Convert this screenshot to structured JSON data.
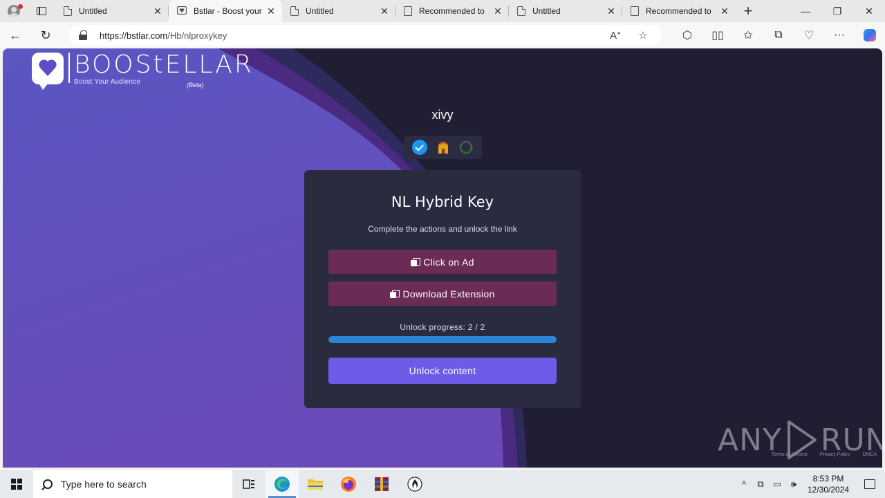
{
  "browser": {
    "tabs": [
      {
        "label": "Untitled",
        "icon": "page-icon"
      },
      {
        "label": "Bstlar - Boost your",
        "icon": "boostellar-favicon",
        "active": true
      },
      {
        "label": "Untitled",
        "icon": "page-icon"
      },
      {
        "label": "Recommended to",
        "icon": "document-icon"
      },
      {
        "label": "Untitled",
        "icon": "page-icon"
      },
      {
        "label": "Recommended to",
        "icon": "document-icon"
      }
    ],
    "url_host": "https://bstlar.com",
    "url_path": "/Hb/nlproxykey",
    "tab_close_glyph": "✕",
    "new_tab_glyph": "+",
    "min_glyph": "—",
    "restore_glyph": "❐",
    "close_glyph": "✕",
    "back_glyph": "←",
    "reload_glyph": "↻",
    "read_aloud_glyph": "Aᐩ",
    "favorite_glyph": "☆",
    "extensions_glyph": "⬡",
    "split_glyph": "▯▯",
    "favorites_glyph": "✩",
    "collections_glyph": "⧉",
    "performance_glyph": "♡",
    "more_glyph": "···"
  },
  "page": {
    "logo": {
      "wordmark": "BOOStELLAR",
      "tagline": "Boost Your Audience",
      "beta": "(Beta)"
    },
    "username": "xivy",
    "badges": [
      "verified-badge",
      "spartan-helmet-badge",
      "laurel-wreath-badge"
    ],
    "card": {
      "title": "NL Hybrid Key",
      "subtitle": "Complete the actions and unlock the link",
      "actions": [
        {
          "label": "Click on Ad"
        },
        {
          "label": "Download Extension"
        }
      ],
      "progress_label": "Unlock progress: 2 / 2",
      "progress_fraction": 1.0,
      "unlock_label": "Unlock content"
    },
    "footer_links": [
      "Terms of Service",
      "Privacy Policy",
      "DMCA"
    ],
    "watermark": {
      "left": "ANY",
      "right": "RUN"
    },
    "colors": {
      "action_bg": "#6a2c54",
      "unlock_bg": "#6c5ce7",
      "progress_fill": "#2b86d8",
      "card_bg": "#2b2b40"
    }
  },
  "taskbar": {
    "search_placeholder": "Type here to search",
    "apps": [
      "task-view-icon",
      "edge-icon",
      "file-explorer-icon",
      "firefox-icon",
      "winrar-icon",
      "anyrun-icon"
    ],
    "tray_chevron": "^",
    "time": "8:53 PM",
    "date": "12/30/2024"
  }
}
